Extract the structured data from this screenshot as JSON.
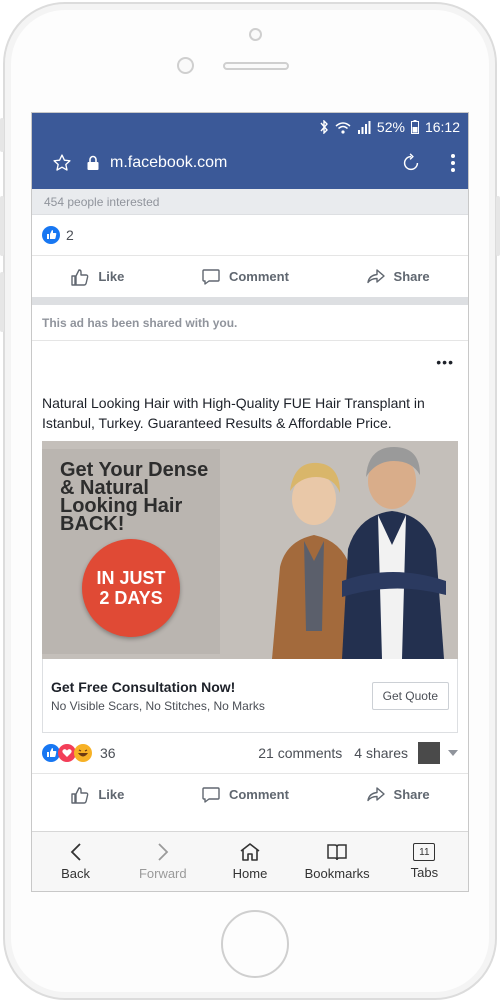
{
  "status_bar": {
    "battery": "52%",
    "time": "16:12"
  },
  "address_bar": {
    "url": "m.facebook.com"
  },
  "previous_post": {
    "interested": "454 people interested",
    "reaction_count": "2",
    "actions": {
      "like": "Like",
      "comment": "Comment",
      "share": "Share"
    }
  },
  "shared_notice": "This ad has been shared with you.",
  "ad_post": {
    "menu": "•••",
    "text": "Natural Looking Hair with High-Quality FUE Hair Transplant in Istanbul, Turkey. Guaranteed Results & Affordable Price.",
    "image": {
      "headline": "Get Your Dense & Natural Looking Hair BACK!",
      "badge": "IN JUST 2 DAYS"
    },
    "link_title": "Get Free Consultation Now!",
    "link_description": "No Visible Scars, No Stitches, No Marks",
    "cta": "Get Quote",
    "reaction_count": "36",
    "comments": "21 comments",
    "shares": "4 shares",
    "actions": {
      "like": "Like",
      "comment": "Comment",
      "share": "Share"
    }
  },
  "bottom_nav": {
    "back": "Back",
    "forward": "Forward",
    "home": "Home",
    "bookmarks": "Bookmarks",
    "tabs": "Tabs",
    "tab_count": "11"
  },
  "colors": {
    "facebook_blue": "#3b5998",
    "like_blue": "#1877f2",
    "love_red": "#f33e58",
    "haha_yellow": "#f7b125",
    "badge_red": "#e04a35"
  }
}
